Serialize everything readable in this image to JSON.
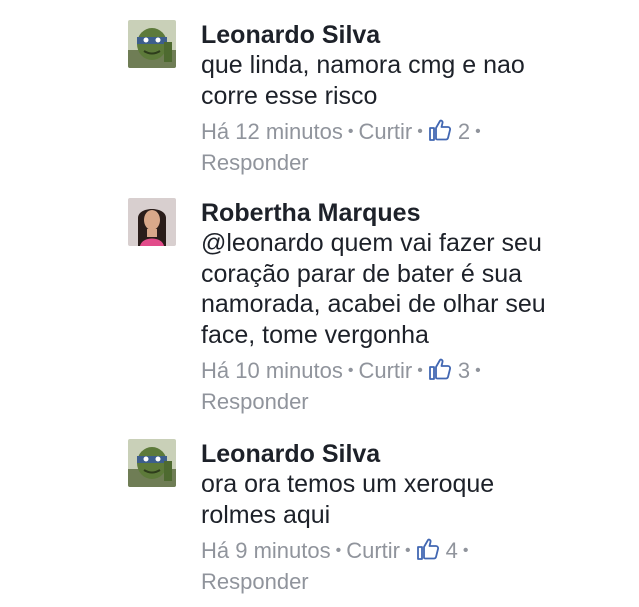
{
  "comments": [
    {
      "author": "Leonardo Silva",
      "avatar": "ninja-turtle-avatar",
      "text": "que linda, namora cmg e nao\ncorre esse risco",
      "time": "Há 12 minutos",
      "like_label": "Curtir",
      "like_count": "2",
      "reply_label": "Responder"
    },
    {
      "author": "Robertha Marques",
      "avatar": "woman-photo-avatar",
      "text": "@leonardo quem vai fazer seu\ncoração parar de bater é sua\nnamorada, acabei de olhar seu\nface, tome vergonha",
      "time": "Há 10 minutos",
      "like_label": "Curtir",
      "like_count": "3",
      "reply_label": "Responder"
    },
    {
      "author": "Leonardo Silva",
      "avatar": "ninja-turtle-avatar",
      "text": "ora ora temos um xeroque\nrolmes aqui",
      "time": "Há 9 minutos",
      "like_label": "Curtir",
      "like_count": "4",
      "reply_label": "Responder"
    }
  ],
  "colors": {
    "text": "#1d2129",
    "meta": "#90949c",
    "like_icon": "#4267b2"
  }
}
